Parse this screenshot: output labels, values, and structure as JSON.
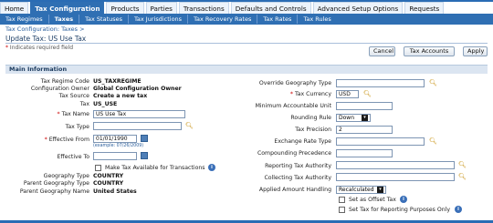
{
  "tabs": [
    "Home",
    "Tax Configuration",
    "Products",
    "Parties",
    "Transactions",
    "Defaults and Controls",
    "Advanced Setup Options",
    "Requests"
  ],
  "subtabs": [
    "Tax Regimes",
    "Taxes",
    "Tax Statuses",
    "Tax Jurisdictions",
    "Tax Recovery Rates",
    "Tax Rates",
    "Tax Rules"
  ],
  "breadcrumb": "Tax Configuration: Taxes >",
  "page_title": "Update Tax: US Use Tax",
  "required_note": "Indicates required field",
  "buttons": {
    "cancel": "Cancel",
    "tax_accounts": "Tax Accounts",
    "apply": "Apply"
  },
  "section_title": "Main Information",
  "left": {
    "regime_code_label": "Tax Regime Code",
    "regime_code": "US_TAXREGIME",
    "config_owner_label": "Configuration Owner",
    "config_owner": "Global Configuration Owner",
    "tax_source_label": "Tax Source",
    "tax_source": "Create a new tax",
    "tax_label": "Tax",
    "tax": "US_USE",
    "tax_name_label": "Tax Name",
    "tax_name": "US Use Tax",
    "tax_type_label": "Tax Type",
    "tax_type": "",
    "eff_from_label": "Effective From",
    "eff_from": "01/01/1990",
    "eff_from_hint": "(example: 07/26/2009)",
    "eff_to_label": "Effective To",
    "eff_to": "",
    "make_available_label": "Make Tax Available for Transactions",
    "geo_type_label": "Geography Type",
    "geo_type": "COUNTRY",
    "parent_geo_type_label": "Parent Geography Type",
    "parent_geo_type": "COUNTRY",
    "parent_geo_name_label": "Parent Geography Name",
    "parent_geo_name": "United States"
  },
  "right": {
    "override_geo_label": "Override Geography Type",
    "override_geo": "",
    "currency_label": "Tax Currency",
    "currency": "USD",
    "min_unit_label": "Minimum Accountable Unit",
    "min_unit": "",
    "rounding_label": "Rounding Rule",
    "rounding": "Down",
    "precision_label": "Tax Precision",
    "precision": "2",
    "exch_type_label": "Exchange Rate Type",
    "exch_type": "",
    "compounding_label": "Compounding Precedence",
    "compounding": "",
    "reporting_auth_label": "Reporting Tax Authority",
    "reporting_auth": "",
    "collecting_auth_label": "Collecting Tax Authority",
    "collecting_auth": "",
    "applied_amount_label": "Applied Amount Handling",
    "applied_amount": "Recalculated",
    "offset_label": "Set as Offset Tax",
    "reporting_only_label": "Set Tax for Reporting Purposes Only"
  }
}
